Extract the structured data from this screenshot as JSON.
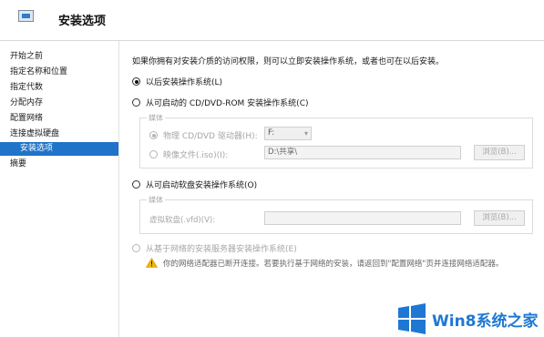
{
  "window": {
    "title": "安装选项"
  },
  "sidebar": {
    "items": [
      {
        "label": "开始之前"
      },
      {
        "label": "指定名称和位置"
      },
      {
        "label": "指定代数"
      },
      {
        "label": "分配内存"
      },
      {
        "label": "配置网络"
      },
      {
        "label": "连接虚拟硬盘"
      },
      {
        "label": "安装选项",
        "selected": true
      },
      {
        "label": "摘要"
      }
    ]
  },
  "main": {
    "intro": "如果你拥有对安装介质的访问权限，则可以立即安装操作系统，或者也可在以后安装。",
    "option_later": {
      "label": "以后安装操作系统(L)",
      "selected": true
    },
    "option_dvd": {
      "label": "从可启动的 CD/DVD-ROM 安装操作系统(C)",
      "media_legend": "媒体",
      "physical_label": "物理 CD/DVD 驱动器(H):",
      "physical_value": "F:",
      "image_label": "映像文件(.iso)(I):",
      "image_value": "D:\\共享\\",
      "browse_label": "浏览(B)..."
    },
    "option_floppy": {
      "label": "从可启动软盘安装操作系统(O)",
      "media_legend": "媒体",
      "vfd_label": "虚拟软盘(.vfd)(V):",
      "vfd_value": "",
      "browse_label": "浏览(B)..."
    },
    "option_network": {
      "label": "从基于网络的安装服务器安装操作系统(E)",
      "warning": "你的网络适配器已断开连接。若要执行基于网络的安装，请返回到\"配置网络\"页并连接网络适配器。"
    }
  },
  "watermark": {
    "text": "Win8系统之家"
  },
  "icons": {
    "header": "wizard-window-icon",
    "warning": "warning-triangle-icon",
    "watermark_logo": "windows-logo-icon"
  },
  "colors": {
    "selection": "#1f73c9",
    "watermark": "#1e78d3",
    "warning": "#f2b705"
  }
}
